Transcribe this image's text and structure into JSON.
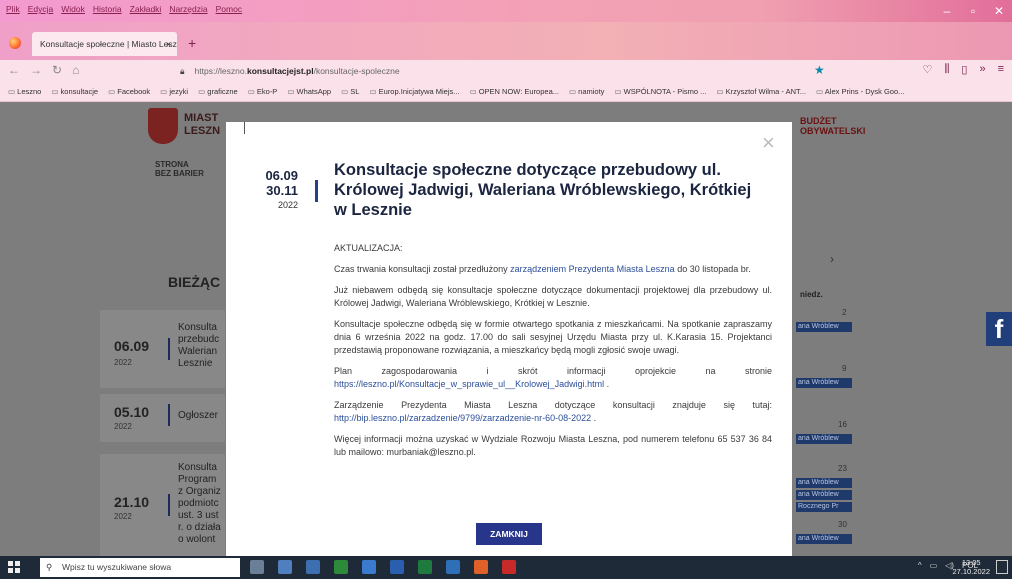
{
  "browser": {
    "menu": [
      "Plik",
      "Edycja",
      "Widok",
      "Historia",
      "Zakładki",
      "Narzędzia",
      "Pomoc"
    ],
    "tab_title": "Konsultacje społeczne | Miasto Leszn",
    "tab_close": "×",
    "new_tab": "+",
    "url_prefix": "https://leszno.",
    "url_domain": "konsultacjejst.pl",
    "url_path": "/konsultacje-spoleczne",
    "bookmarks": [
      "Leszno",
      "konsultacje",
      "Facebook",
      "jezyki",
      "graficzne",
      "Eko-P",
      "WhatsApp",
      "SL",
      "Europ.Inicjatywa Miejs...",
      "OPEN NOW: Europea...",
      "namioty",
      "WSPÓLNOTA - Pismo ...",
      "Krzysztof Wilma - ANT...",
      "Alex Prins - Dysk Goo..."
    ]
  },
  "page": {
    "logo_line1": "MIAST",
    "logo_line2": "LESZN",
    "barrier_line1": "STRONA",
    "barrier_line2": "BEZ BARIER",
    "budzet_line1": "BUDŻET",
    "budzet_line2": "OBYWATELSKI",
    "section_title": "BIEŻĄC",
    "cards": [
      {
        "date": "06.09",
        "year": "2022",
        "text": "Konsulta\nprzebudc\nWalerian\nLesznie"
      },
      {
        "date": "05.10",
        "year": "2022",
        "text": "Ogłoszer"
      },
      {
        "date": "21.10",
        "year": "2022",
        "text": "Konsulta\nProgram\nz Organiz\npodmiotc\nust. 3 ust\nr. o działa\no wolont"
      }
    ],
    "calendar": {
      "chevron": "›",
      "header": "niedz.",
      "days": [
        "2",
        "9",
        "16",
        "23",
        "30"
      ],
      "events": [
        "ana Wróblew",
        "ana Wróblew",
        "ana Wróblew",
        "ana Wróblew",
        "ana Wróblew",
        "Rocznego Pr",
        "ana Wróblew"
      ]
    },
    "fb": "f"
  },
  "modal": {
    "date_start": "06.09",
    "date_end": "30.11",
    "year": "2022",
    "title": "Konsultacje społeczne dotyczące przebudowy ul. Królowej Jadwigi, Waleriana Wróblewskiego, Krótkiej w Lesznie",
    "close": "×",
    "update_label": "AKTUALIZACJA:",
    "p1_before": "Czas trwania konsultacji został przedłużony ",
    "p1_link": "zarządzeniem Prezydenta Miasta Leszna",
    "p1_after": " do 30 listopada br.",
    "p2": "Już niebawem odbędą się konsultacje społeczne dotyczące dokumentacji projektowej dla przebudowy ul. Królowej Jadwigi, Waleriana Wróblewskiego, Krótkiej w Lesznie.",
    "p3": "Konsultacje społeczne odbędą się w formie otwartego spotkania z mieszkańcami. Na spotkanie zapraszamy dnia 6 września 2022 na godz. 17.00 do sali sesyjnej Urzędu Miasta przy ul. K.Karasia 15. Projektanci przedstawią proponowane rozwiązania, a mieszkańcy będą mogli zgłosić swoje uwagi.",
    "p4_before": "Plan zagospodarowania i skrót informacji oprojekcie na stronie ",
    "p4_link": "https://leszno.pl/Konsultacje_w_sprawie_ul__Krolowej_Jadwigi.html",
    "p4_after": " .",
    "p5_before": "Zarządzenie Prezydenta Miasta Leszna dotyczące konsultacji znajduje się tutaj: ",
    "p5_link": "http://bip.leszno.pl/zarzadzenie/9799/zarzadzenie-nr-60-08-2022",
    "p5_after": " .",
    "p6": "Więcej informacji można uzyskać w Wydziale Rozwoju Miasta Leszna, pod numerem telefonu 65 537 36 84 lub mailowo: murbaniak@leszno.pl.",
    "button": "ZAMKNIJ"
  },
  "taskbar": {
    "search_placeholder": "Wpisz tu wyszukiwane słowa",
    "lang": "POL",
    "time": "13:05",
    "date": "27.10.2022"
  }
}
